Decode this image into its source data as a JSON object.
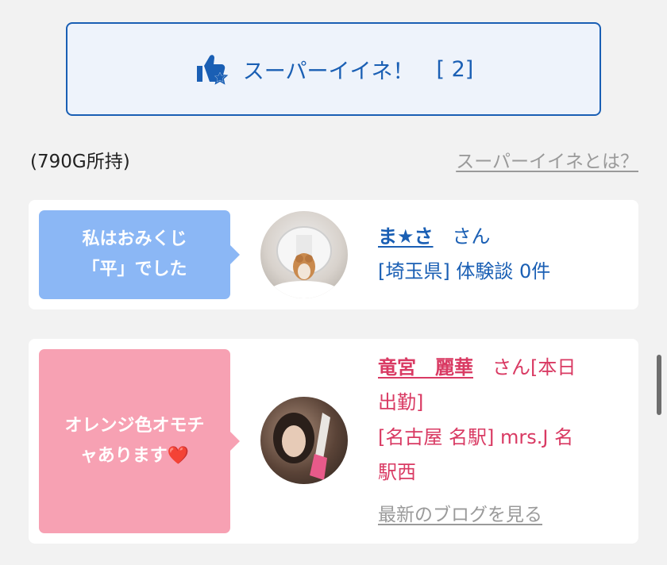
{
  "super_like": {
    "label": "スーパーイイネ！",
    "count": "[ 2]",
    "icon": "thumbs-up-star-icon"
  },
  "points": {
    "text": "(790G所持)"
  },
  "about_link": {
    "text": "スーパーイイネとは？"
  },
  "reviewers": [
    {
      "bubble_line1": "私はおみくじ",
      "bubble_line2": "「平」でした",
      "name": "ま★さ",
      "honorific": "さん",
      "detail": "[埼玉県] 体験談 0件",
      "avatar": "hamster-photo"
    },
    {
      "bubble_line1": "オレンジ色オモチ",
      "bubble_line2": "ャあります",
      "bubble_emoji": "❤️",
      "name": "竜宮　麗華",
      "honorific": "さん[本日",
      "honorific_line2": "出勤]",
      "detail_line1": "[名古屋 名駅] mrs.J 名",
      "detail_line2": "駅西",
      "blog_link": "最新のブログを見る",
      "avatar": "woman-with-champagne-photo"
    }
  ],
  "colors": {
    "accent": "#1a5fb4",
    "pink": "#d93a63",
    "bubble_blue": "#8bb7f5",
    "bubble_pink": "#f7a1b3"
  }
}
